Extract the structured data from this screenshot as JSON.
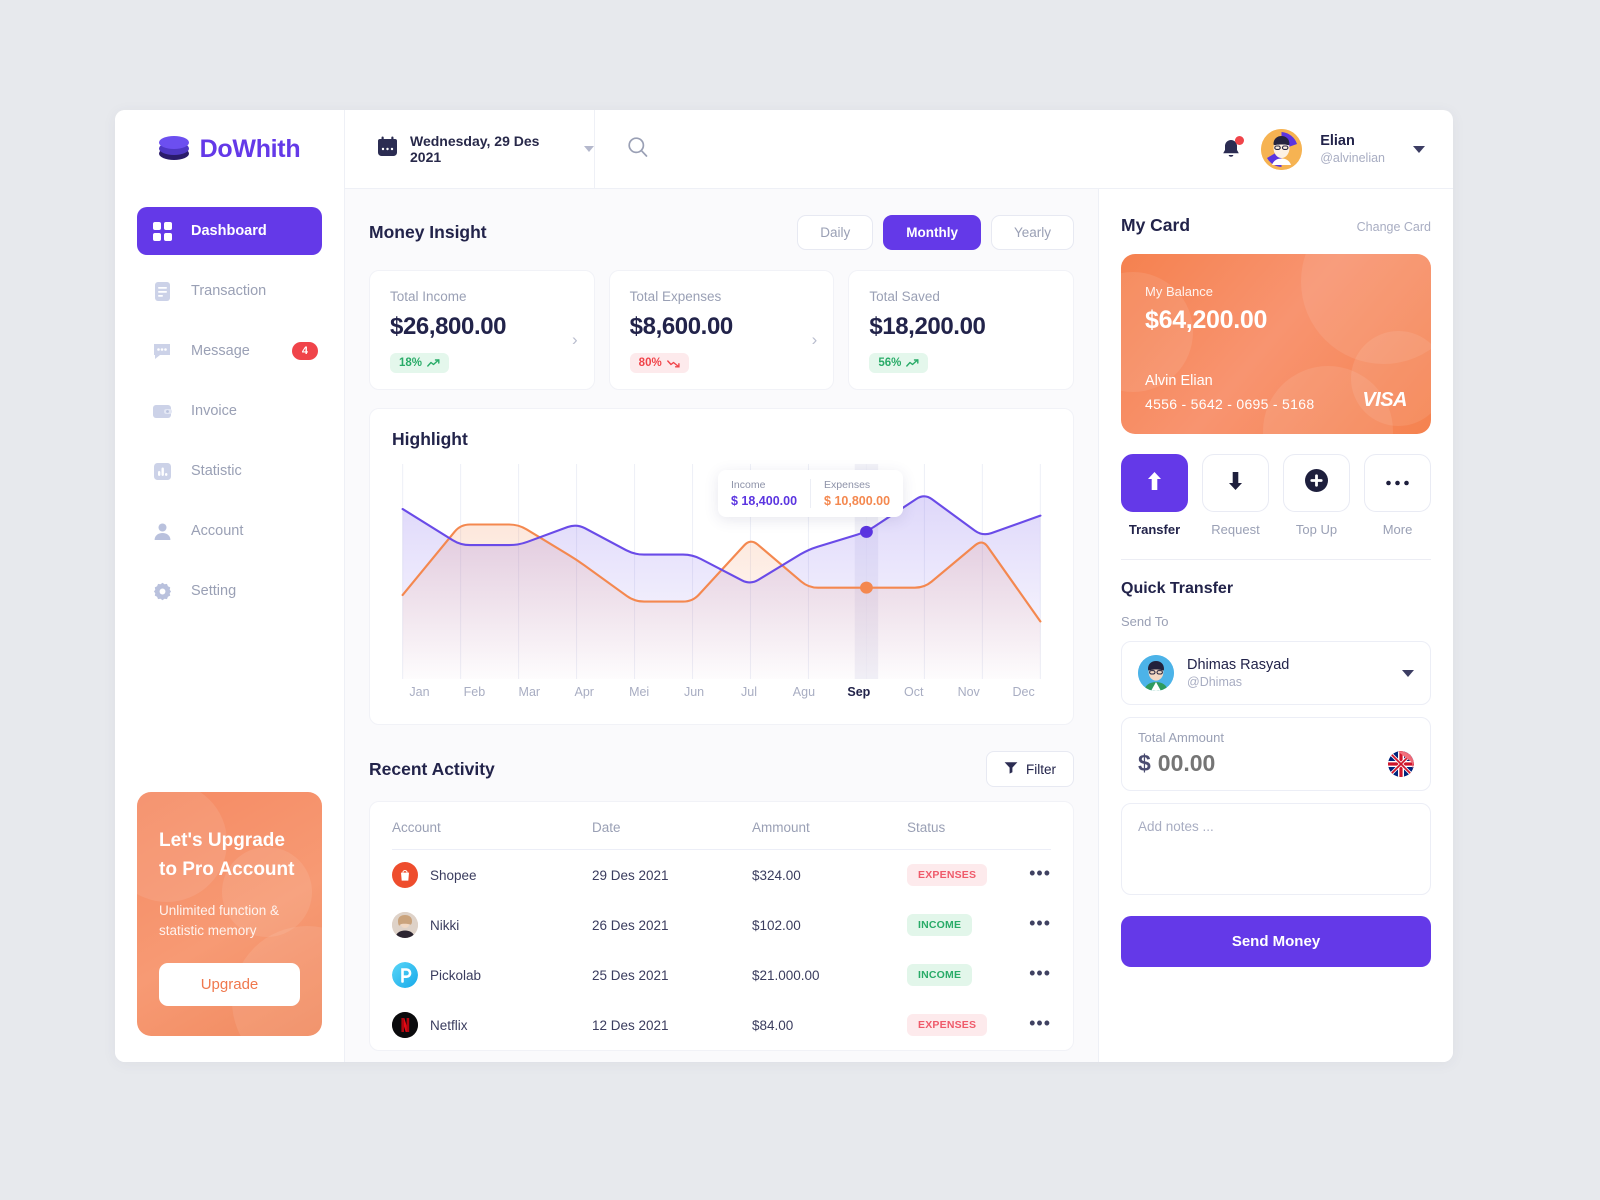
{
  "brand": {
    "name": "DoWhith",
    "logo_icon": "database-stack-icon"
  },
  "sidebar": {
    "items": [
      {
        "label": "Dashboard",
        "icon": "grid-icon",
        "active": true,
        "badge": ""
      },
      {
        "label": "Transaction",
        "icon": "document-icon",
        "active": false,
        "badge": ""
      },
      {
        "label": "Message",
        "icon": "chat-bubble-icon",
        "active": false,
        "badge": "4"
      },
      {
        "label": "Invoice",
        "icon": "wallet-icon",
        "active": false,
        "badge": ""
      },
      {
        "label": "Statistic",
        "icon": "bar-chart-icon",
        "active": false,
        "badge": ""
      },
      {
        "label": "Account",
        "icon": "person-icon",
        "active": false,
        "badge": ""
      },
      {
        "label": "Setting",
        "icon": "gear-icon",
        "active": false,
        "badge": ""
      }
    ],
    "promo": {
      "title": "Let's Upgrade to Pro Account",
      "subtitle": "Unlimited function & statistic memory",
      "button": "Upgrade"
    }
  },
  "topbar": {
    "date": "Wednesday, 29 Des 2021",
    "calendar_icon": "calendar-icon",
    "search_placeholder": "",
    "search_value": "",
    "notification_icon": "bell-icon",
    "user": {
      "name": "Elian",
      "handle": "@alvinelian"
    }
  },
  "money_insight": {
    "title": "Money Insight",
    "ranges": [
      {
        "label": "Daily",
        "active": false
      },
      {
        "label": "Monthly",
        "active": true
      },
      {
        "label": "Yearly",
        "active": false
      }
    ],
    "stats": [
      {
        "label": "Total Income",
        "value": "$26,800.00",
        "delta": "18%",
        "trend": "up",
        "chevron": true
      },
      {
        "label": "Total Expenses",
        "value": "$8,600.00",
        "delta": "80%",
        "trend": "down",
        "chevron": true
      },
      {
        "label": "Total Saved",
        "value": "$18,200.00",
        "delta": "56%",
        "trend": "up",
        "chevron": false
      }
    ]
  },
  "highlight": {
    "title": "Highlight",
    "tooltip": {
      "income_label": "Income",
      "income_value": "$ 18,400.00",
      "expenses_label": "Expenses",
      "expenses_value": "$ 10,800.00"
    }
  },
  "chart_data": {
    "type": "line",
    "title": "Highlight",
    "xlabel": "",
    "ylabel": "",
    "grid": true,
    "legend": "none",
    "selected_category": "Sep",
    "categories": [
      "Jan",
      "Feb",
      "Mar",
      "Apr",
      "Mei",
      "Jun",
      "Jul",
      "Agu",
      "Sep",
      "Oct",
      "Nov",
      "Dec"
    ],
    "ylim": [
      0,
      26000
    ],
    "series": [
      {
        "name": "Income",
        "color": "#6a4be8",
        "values": [
          21500,
          16600,
          16600,
          19500,
          15300,
          15300,
          11200,
          16000,
          18400,
          23600,
          17800,
          20600
        ]
      },
      {
        "name": "Expenses",
        "color": "#f4884f",
        "values": [
          9800,
          19400,
          19400,
          14600,
          8900,
          8900,
          17500,
          10800,
          10800,
          10800,
          17400,
          6200
        ]
      }
    ]
  },
  "recent_activity": {
    "title": "Recent Activity",
    "filter_label": "Filter",
    "filter_icon": "funnel-icon",
    "columns": [
      "Account",
      "Date",
      "Ammount",
      "Status"
    ],
    "rows": [
      {
        "account": "Shopee",
        "icon": "shopee-logo-icon",
        "date": "29 Des 2021",
        "amount": "$324.00",
        "status": "EXPENSES"
      },
      {
        "account": "Nikki",
        "icon": "user-photo-icon",
        "date": "26 Des 2021",
        "amount": "$102.00",
        "status": "INCOME"
      },
      {
        "account": "Pickolab",
        "icon": "pickolab-logo-icon",
        "date": "25 Des 2021",
        "amount": "$21.000.00",
        "status": "INCOME"
      },
      {
        "account": "Netflix",
        "icon": "netflix-logo-icon",
        "date": "12 Des 2021",
        "amount": "$84.00",
        "status": "EXPENSES"
      }
    ],
    "row_menu_icon": "more-horizontal-icon"
  },
  "my_card": {
    "title": "My Card",
    "change_card": "Change Card",
    "balance_label": "My Balance",
    "balance_value": "$64,200.00",
    "owner": "Alvin Elian",
    "number": "4556 - 5642 - 0695 - 5168",
    "network": "VISA"
  },
  "card_actions": [
    {
      "label": "Transfer",
      "icon": "upload-arrow-icon",
      "active": true
    },
    {
      "label": "Request",
      "icon": "download-arrow-icon",
      "active": false
    },
    {
      "label": "Top Up",
      "icon": "plus-circle-icon",
      "active": false
    },
    {
      "label": "More",
      "icon": "more-horizontal-icon",
      "active": false
    }
  ],
  "quick_transfer": {
    "title": "Quick Transfer",
    "send_to_label": "Send To",
    "recipient": {
      "name": "Dhimas Rasyad",
      "handle": "@Dhimas",
      "avatar_icon": "avatar-icon"
    },
    "amount_label": "Total Ammount",
    "amount_currency": "$",
    "amount_value": "",
    "amount_placeholder": "00.00",
    "flag_icon": "uk-flag-icon",
    "notes_value": "",
    "notes_placeholder": "Add notes ...",
    "send_button": "Send Money"
  },
  "colors": {
    "accent": "#6439e8",
    "orange": "#f5814f",
    "green": "#29ab68",
    "red": "#f0444a",
    "income_line": "#6a4be8",
    "expense_line": "#f4884f"
  }
}
